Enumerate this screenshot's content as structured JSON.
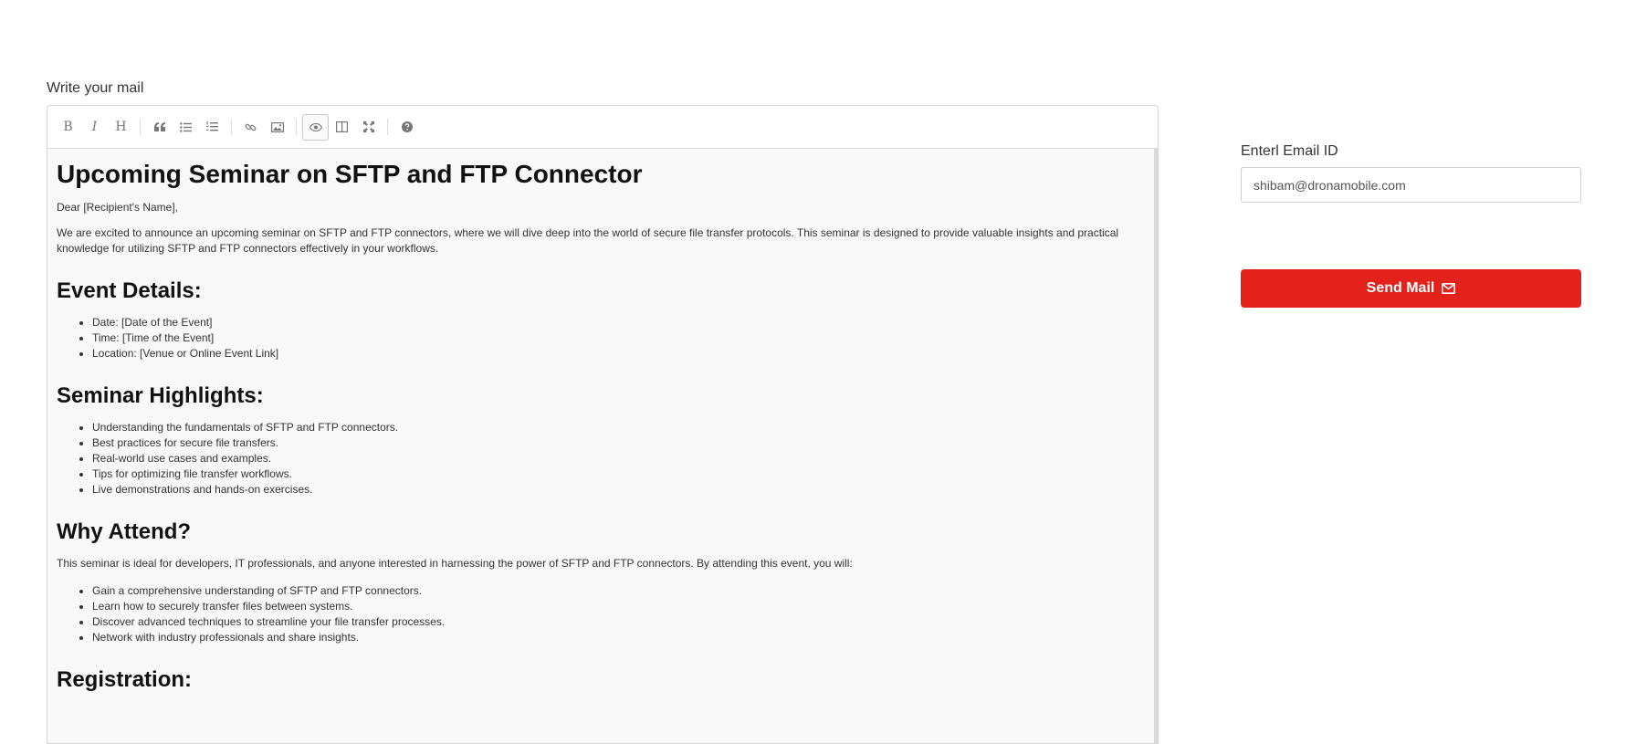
{
  "editor": {
    "label": "Write your mail",
    "toolbar": {
      "bold": "B",
      "italic": "I",
      "heading": "H"
    },
    "content": {
      "title": "Upcoming Seminar on SFTP and FTP Connector",
      "greeting": "Dear [Recipient's Name],",
      "intro": "We are excited to announce an upcoming seminar on SFTP and FTP connectors, where we will dive deep into the world of secure file transfer protocols. This seminar is designed to provide valuable insights and practical knowledge for utilizing SFTP and FTP connectors effectively in your workflows.",
      "event_heading": "Event Details:",
      "event_items": [
        "Date: [Date of the Event]",
        "Time: [Time of the Event]",
        "Location: [Venue or Online Event Link]"
      ],
      "highlights_heading": "Seminar Highlights:",
      "highlights_items": [
        "Understanding the fundamentals of SFTP and FTP connectors.",
        "Best practices for secure file transfers.",
        "Real-world use cases and examples.",
        "Tips for optimizing file transfer workflows.",
        "Live demonstrations and hands-on exercises."
      ],
      "why_heading": "Why Attend?",
      "why_text": "This seminar is ideal for developers, IT professionals, and anyone interested in harnessing the power of SFTP and FTP connectors. By attending this event, you will:",
      "why_items": [
        "Gain a comprehensive understanding of SFTP and FTP connectors.",
        "Learn how to securely transfer files between systems.",
        "Discover advanced techniques to streamline your file transfer processes.",
        "Network with industry professionals and share insights."
      ],
      "registration_heading": "Registration:"
    }
  },
  "recipient": {
    "label": "Enterl Email ID",
    "value": "shibam@dronamobile.com"
  },
  "send_button": {
    "label": "Send Mail"
  },
  "colors": {
    "accent": "#e3231b"
  }
}
